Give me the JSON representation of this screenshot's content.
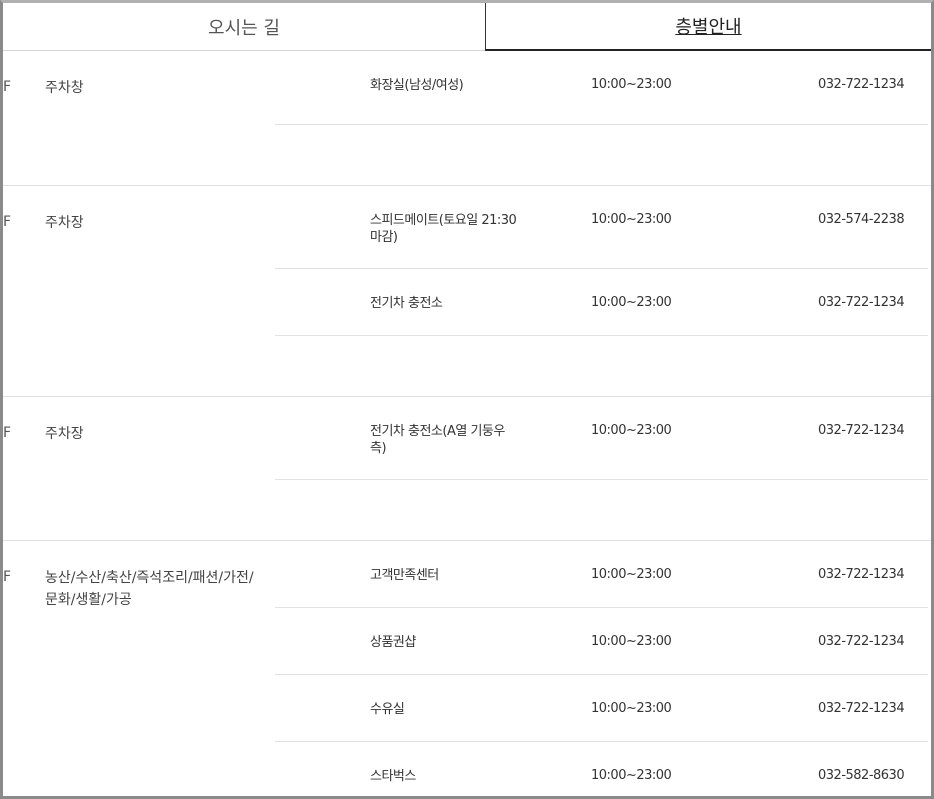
{
  "tabs": [
    {
      "label": "오시는 길"
    },
    {
      "label": "층별안내"
    }
  ],
  "floors": [
    {
      "code": "F",
      "name": "주차창",
      "rows": [
        {
          "facility": "화장실(남성/여성)",
          "hours": "10:00~23:00",
          "phone": "032-722-1234"
        },
        {
          "facility": "",
          "hours": "",
          "phone": ""
        }
      ]
    },
    {
      "code": "F",
      "name": "주차장",
      "rows": [
        {
          "facility": "스피드메이트(토요일 21:30마감)",
          "hours": "10:00~23:00",
          "phone": "032-574-2238"
        },
        {
          "facility": "전기차 충전소",
          "hours": "10:00~23:00",
          "phone": "032-722-1234"
        },
        {
          "facility": "",
          "hours": "",
          "phone": ""
        }
      ]
    },
    {
      "code": "F",
      "name": "주차장",
      "rows": [
        {
          "facility": "전기차 충전소(A열 기둥우측)",
          "hours": "10:00~23:00",
          "phone": "032-722-1234"
        },
        {
          "facility": "",
          "hours": "",
          "phone": ""
        }
      ]
    },
    {
      "code": "F",
      "name": "농산/수산/축산/즉석조리/패션/가전/문화/생활/가공",
      "rows": [
        {
          "facility": "고객만족센터",
          "hours": "10:00~23:00",
          "phone": "032-722-1234"
        },
        {
          "facility": "상품권샵",
          "hours": "10:00~23:00",
          "phone": "032-722-1234"
        },
        {
          "facility": "수유실",
          "hours": "10:00~23:00",
          "phone": "032-722-1234"
        },
        {
          "facility": "스타벅스",
          "hours": "10:00~23:00",
          "phone": "032-582-8630"
        }
      ]
    }
  ]
}
